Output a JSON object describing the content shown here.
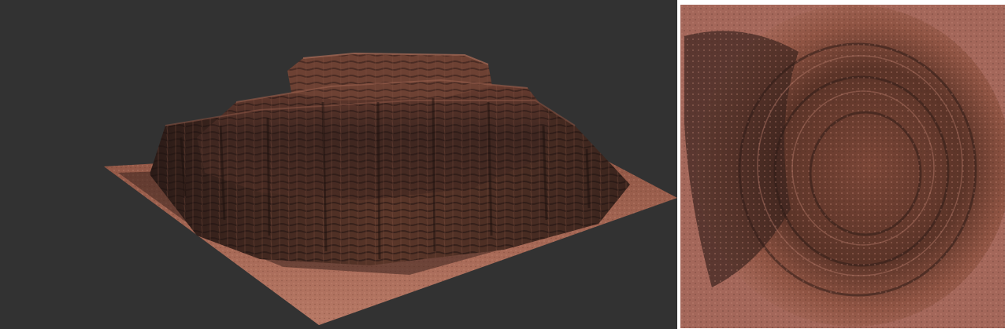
{
  "colors": {
    "viewport_background": "#323232",
    "ground_base": "#a26452",
    "ground_light": "#c2826d",
    "rock_dark": "#2a1a17",
    "rock_mid": "#5a3328",
    "rock_light": "#8a5240",
    "texture_base": "#9e5e4c",
    "texture_shadow": "#3a2520"
  },
  "panels": {
    "left": "3d-terrain-render-view",
    "right": "top-down-heightmap-texture-view"
  }
}
